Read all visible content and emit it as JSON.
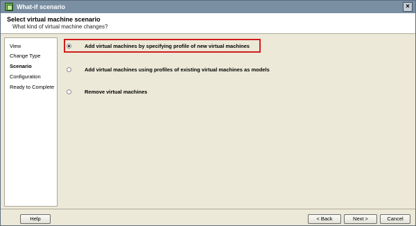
{
  "window": {
    "title": "What-if scenario",
    "close_glyph": "×"
  },
  "header": {
    "title": "Select virtual machine scenario",
    "subtitle": "What kind of virtual machine changes?"
  },
  "sidebar": {
    "items": [
      {
        "label": "View",
        "active": false
      },
      {
        "label": "Change Type",
        "active": false
      },
      {
        "label": "Scenario",
        "active": true
      },
      {
        "label": "Configuration",
        "active": false
      },
      {
        "label": "Ready to Complete",
        "active": false
      }
    ]
  },
  "options": [
    {
      "label": "Add virtual machines by specifying profile of new virtual machines",
      "selected": true
    },
    {
      "label": "Add virtual machines using profiles of existing virtual machines as models",
      "selected": false
    },
    {
      "label": "Remove virtual machines",
      "selected": false
    }
  ],
  "footer": {
    "help": "Help",
    "back": "< Back",
    "next": "Next >",
    "cancel": "Cancel"
  },
  "colors": {
    "titlebar": "#7b8fa3",
    "panel": "#ece9d8",
    "highlight_border": "#d11b1b"
  }
}
